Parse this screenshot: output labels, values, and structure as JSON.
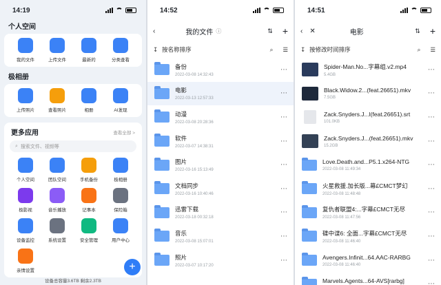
{
  "left": {
    "time": "14:19",
    "personal_title": "个人空间",
    "personal_items": [
      {
        "label": "我的文件",
        "color": "#3b82f6",
        "icon": "person"
      },
      {
        "label": "上传文件",
        "color": "#3b82f6",
        "icon": "upload"
      },
      {
        "label": "最新的",
        "color": "#3b82f6",
        "icon": "new"
      },
      {
        "label": "分类查看",
        "color": "#3b82f6",
        "icon": "pie"
      }
    ],
    "album_title": "极相册",
    "album_items": [
      {
        "label": "上传照片",
        "color": "#3b82f6",
        "icon": "upload"
      },
      {
        "label": "查看照片",
        "color": "#f59e0b",
        "icon": "photo"
      },
      {
        "label": "相册",
        "color": "#3b82f6",
        "icon": "album"
      },
      {
        "label": "AI发现",
        "color": "#3b82f6",
        "icon": "ai"
      }
    ],
    "apps_title": "更多应用",
    "apps_more": "查看全部 >",
    "search_placeholder": "搜索文件、视频等",
    "apps": [
      {
        "label": "个人空间",
        "color": "#3b82f6"
      },
      {
        "label": "团队空间",
        "color": "#3b82f6"
      },
      {
        "label": "手机备份",
        "color": "#f59e0b"
      },
      {
        "label": "极相册",
        "color": "#3b82f6"
      },
      {
        "label": "极影视",
        "color": "#7c3aed"
      },
      {
        "label": "音乐播放",
        "color": "#8b5cf6"
      },
      {
        "label": "记事本",
        "color": "#f97316"
      },
      {
        "label": "保险箱",
        "color": "#6b7280"
      },
      {
        "label": "设备监控",
        "color": "#3b82f6"
      },
      {
        "label": "系统设置",
        "color": "#6b7280"
      },
      {
        "label": "安全管理",
        "color": "#10b981"
      },
      {
        "label": "用户中心",
        "color": "#3b82f6"
      },
      {
        "label": "亲情设置",
        "color": "#f97316"
      }
    ],
    "footer": "设备总容量3.6TB 剩余2.3TB"
  },
  "mid": {
    "time": "14:52",
    "title": "我的文件",
    "sort": "按名称排序",
    "files": [
      {
        "name": "备份",
        "date": "2022-03-08 14:32:43"
      },
      {
        "name": "电影",
        "date": "2022-03-13 12:57:33"
      },
      {
        "name": "动漫",
        "date": "2022-03-08 20:28:36"
      },
      {
        "name": "软件",
        "date": "2022-03-07 14:38:31"
      },
      {
        "name": "图片",
        "date": "2022-03-16 15:13:49"
      },
      {
        "name": "文档同步",
        "date": "2022-03-16 10:40:46"
      },
      {
        "name": "迅雷下载",
        "date": "2022-03-18 00:32:18"
      },
      {
        "name": "音乐",
        "date": "2022-03-08 15:07:01"
      },
      {
        "name": "照片",
        "date": "2022-03-07 10:17:20"
      }
    ]
  },
  "right": {
    "time": "14:51",
    "title": "电影",
    "sort": "按修改时间排序",
    "files": [
      {
        "name": "Spider-Man.No...字幕组.v2.mp4",
        "meta": "5.4GB",
        "type": "video",
        "color": "#2a3b5c"
      },
      {
        "name": "Black.Widow.2...(feat.26651).mkv",
        "meta": "7.5GB",
        "type": "video",
        "color": "#1e293b"
      },
      {
        "name": "Zack.Snyders.J...l(feat.26651).srt",
        "meta": "101.0KB",
        "type": "doc",
        "color": "#e5e7eb"
      },
      {
        "name": "Zack.Snyders.J...(feat.26651).mkv",
        "meta": "15.2GB",
        "type": "video",
        "color": "#334155"
      },
      {
        "name": "Love.Death.and...P5.1.x264-NTG",
        "meta": "2022-03-08 11:49:34",
        "type": "folder"
      },
      {
        "name": "火星救援.加长版...幕£CMCT梦幻",
        "meta": "2022-03-08 11:48:48",
        "type": "folder"
      },
      {
        "name": "复仇者联盟4:...字幕£CMCT无尽",
        "meta": "2022-03-08 11:47:56",
        "type": "folder"
      },
      {
        "name": "碟中谍6: 全面...字幕£CMCT无尽",
        "meta": "2022-03-08 11:46:40",
        "type": "folder"
      },
      {
        "name": "Avengers.Infinit...64.AAC-RARBG",
        "meta": "2022-03-08 11:46:40",
        "type": "folder"
      },
      {
        "name": "Marvels.Agents...64-AVS[rarbg]",
        "meta": "2022-03-08 11:46:20",
        "type": "folder"
      }
    ]
  }
}
